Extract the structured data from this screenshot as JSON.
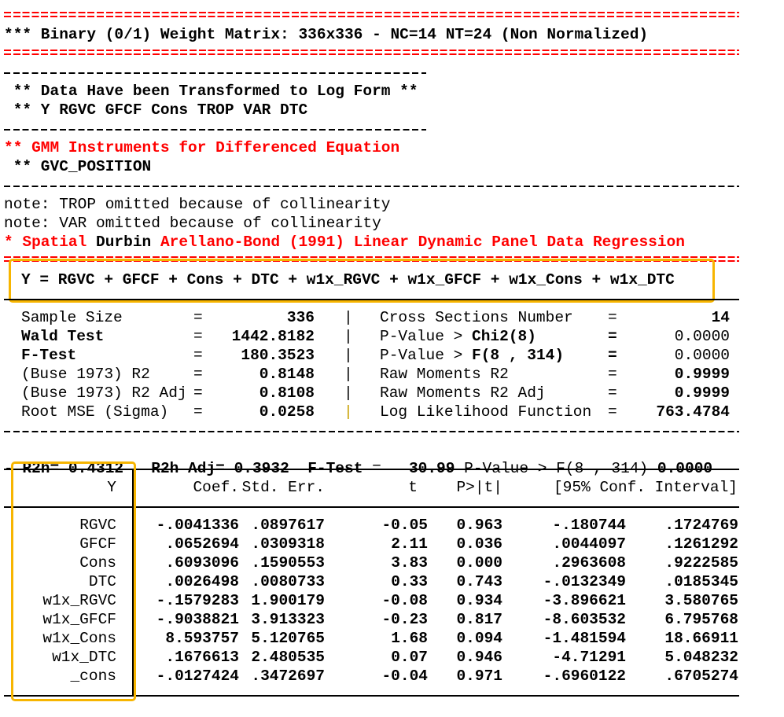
{
  "header": {
    "weight_matrix": "*** Binary (0/1) Weight Matrix: 336x336 - NC=14 NT=24 (Non Normalized)",
    "transform_note": " ** Data Have been Transformed to Log Form **",
    "transform_vars": " ** Y RGVC GFCF Cons TROP VAR DTC",
    "gmm_title": "** GMM Instruments for Differenced Equation",
    "gmm_var": " ** GVC_POSITION",
    "note1": "note: TROP omitted because of collinearity",
    "note2": "note: VAR omitted because of collinearity",
    "model_prefix": "* Spatial ",
    "model_durbin": "Durbin",
    "model_suffix": " Arellano-Bond (1991) Linear Dynamic Panel Data Regression",
    "equation": "Y = RGVC + GFCF + Cons + DTC + w1x_RGVC + w1x_GFCF + w1x_Cons + w1x_DTC"
  },
  "stats": [
    {
      "label": "Sample Size",
      "label_bold": false,
      "eq": "=",
      "value": "336",
      "rlabel": "Cross Sections Number",
      "rbold": "",
      "rtail": "",
      "req": "=",
      "rvalue": "14",
      "rvalue_bold": true
    },
    {
      "label": "Wald Test",
      "label_bold": true,
      "eq": "=",
      "value": "1442.8182",
      "rlabel": "P-Value > ",
      "rbold": "Chi2",
      "rtail": "(8)",
      "req": "=",
      "rvalue": "0.0000",
      "rvalue_bold": false
    },
    {
      "label": "F-Test",
      "label_bold": true,
      "eq": "=",
      "value": "180.3523",
      "rlabel": "P-Value > ",
      "rbold": "F",
      "rtail": "(8 , 314)",
      "req": "=",
      "rvalue": "0.0000",
      "rvalue_bold": false
    },
    {
      "label": "(Buse 1973) R2",
      "label_bold": false,
      "eq": "=",
      "value": "0.8148",
      "rlabel": "Raw Moments R2",
      "rbold": "",
      "rtail": "",
      "req": "=",
      "rvalue": "0.9999",
      "rvalue_bold": true
    },
    {
      "label": "(Buse 1973) R2 Adj",
      "label_bold": false,
      "eq": "=",
      "value": "0.8108",
      "rlabel": "Raw Moments R2 Adj",
      "rbold": "",
      "rtail": "",
      "req": "=",
      "rvalue": "0.9999",
      "rvalue_bold": true
    },
    {
      "label": "Root MSE (Sigma)",
      "label_bold": false,
      "eq": "=",
      "value": "0.0258",
      "rlabel": "Log Likelihood Function",
      "rbold": "",
      "rtail": "",
      "req": "=",
      "rvalue": "763.4784",
      "rvalue_bold": true
    }
  ],
  "r2h_line": {
    "dash": "-",
    "r2h_label": "R2h=",
    "r2h_value": " 0.4312",
    "r2h_adj_label": "R2h Adj=",
    "r2h_adj_value": " 0.3932",
    "ftest_label": "F-Test",
    "ftest_eq": " =   ",
    "ftest_value": "30.99",
    "pvalue_label": " P-Value > F(8 , 314) ",
    "pvalue_value": "0.0000"
  },
  "table": {
    "headers": [
      "Y",
      "Coef.",
      "Std. Err.",
      "t",
      "P>|t|",
      "[95% Conf. Interval]"
    ],
    "rows": [
      {
        "name": "RGVC",
        "coef": "-.0041336",
        "se": ".0897617",
        "t": "-0.05",
        "p": "0.963",
        "lo": "-.180744",
        "hi": ".1724769"
      },
      {
        "name": "GFCF",
        "coef": ".0652694",
        "se": ".0309318",
        "t": "2.11",
        "p": "0.036",
        "lo": ".0044097",
        "hi": ".1261292"
      },
      {
        "name": "Cons",
        "coef": ".6093096",
        "se": ".1590553",
        "t": "3.83",
        "p": "0.000",
        "lo": ".2963608",
        "hi": ".9222585"
      },
      {
        "name": "DTC",
        "coef": ".0026498",
        "se": ".0080733",
        "t": "0.33",
        "p": "0.743",
        "lo": "-.0132349",
        "hi": ".0185345"
      },
      {
        "name": "w1x_RGVC",
        "coef": "-.1579283",
        "se": "1.900179",
        "t": "-0.08",
        "p": "0.934",
        "lo": "-3.896621",
        "hi": "3.580765"
      },
      {
        "name": "w1x_GFCF",
        "coef": "-.9038821",
        "se": "3.913323",
        "t": "-0.23",
        "p": "0.817",
        "lo": "-8.603532",
        "hi": "6.795768"
      },
      {
        "name": "w1x_Cons",
        "coef": "8.593757",
        "se": "5.120765",
        "t": "1.68",
        "p": "0.094",
        "lo": "-1.481594",
        "hi": "18.66911"
      },
      {
        "name": "w1x_DTC",
        "coef": ".1676613",
        "se": "2.480535",
        "t": "0.07",
        "p": "0.946",
        "lo": "-4.71291",
        "hi": "5.048232"
      },
      {
        "name": "_cons",
        "coef": "-.0127424",
        "se": ".3472697",
        "t": "-0.04",
        "p": "0.971",
        "lo": "-.6960122",
        "hi": ".6705274"
      }
    ]
  },
  "colors": {
    "red": "#ff0000",
    "highlight": "#f7b500"
  }
}
